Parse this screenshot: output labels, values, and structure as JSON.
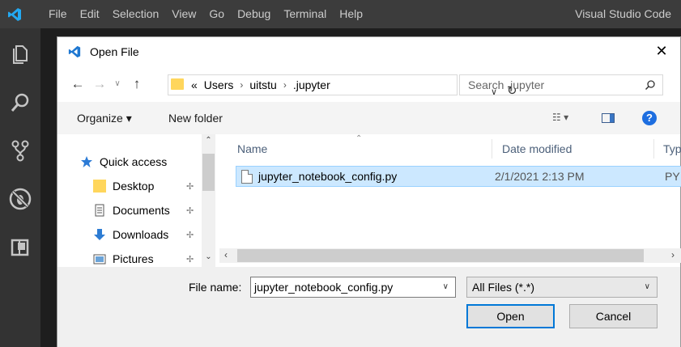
{
  "app": {
    "title": "Visual Studio Code",
    "menu": [
      "File",
      "Edit",
      "Selection",
      "View",
      "Go",
      "Debug",
      "Terminal",
      "Help"
    ],
    "activity_icons": [
      "files-icon",
      "search-icon",
      "source-control-icon",
      "debug-icon",
      "extensions-icon"
    ]
  },
  "dialog": {
    "title": "Open File",
    "close_glyph": "✕",
    "address": {
      "overflow": "«",
      "segments": [
        "Users",
        "uitstu",
        ".jupyter"
      ]
    },
    "search_placeholder": "Search .jupyter",
    "toolbar": {
      "organize": "Organize ▾",
      "new_folder": "New folder",
      "help": "?"
    },
    "nav_pane": {
      "header": "Quick access",
      "items": [
        {
          "label": "Desktop",
          "icon": "desktop-folder-icon"
        },
        {
          "label": "Documents",
          "icon": "documents-icon"
        },
        {
          "label": "Downloads",
          "icon": "downloads-icon"
        },
        {
          "label": "Pictures",
          "icon": "pictures-icon"
        }
      ]
    },
    "columns": [
      "Name",
      "Date modified",
      "Type"
    ],
    "files": [
      {
        "name": "jupyter_notebook_config.py",
        "date": "2/1/2021 2:13 PM",
        "type": "PY Fi"
      }
    ],
    "file_name_label": "File name:",
    "file_name_value": "jupyter_notebook_config.py",
    "file_type": "All Files (*.*)",
    "open_button": "Open",
    "cancel_button": "Cancel"
  },
  "colors": {
    "titlebar": "#3c3c3c",
    "activitybar": "#333333",
    "selection": "#cce8ff",
    "accent": "#0078d7"
  }
}
